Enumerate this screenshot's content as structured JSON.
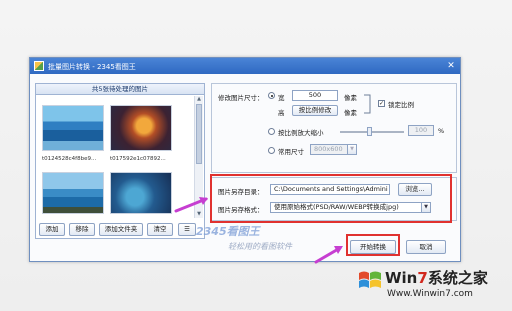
{
  "window": {
    "title": "批量图片转换 - 2345看图王",
    "close_glyph": "✕"
  },
  "left_panel": {
    "header": "共5张待处理的图片",
    "captions": [
      "t0124528c4f8be9...",
      "t017592e1c07892..."
    ],
    "buttons": {
      "add": "添加",
      "remove": "移除",
      "add_folder": "添加文件夹",
      "clear": "清空",
      "view_toggle": "☰"
    }
  },
  "resize": {
    "label": "修改图片尺寸：",
    "width_label": "宽",
    "width_value": "500",
    "width_unit": "像素",
    "height_label": "高",
    "height_button": "按比例修改",
    "height_unit": "像素",
    "lock_ratio_label": "锁定比例",
    "lock_ratio_checked": true,
    "scale_label": "按比例放大缩小",
    "scale_value": "100",
    "scale_unit": "%",
    "common_size_label": "常用尺寸",
    "common_size_value": "800x600"
  },
  "output": {
    "dir_label": "图片另存目录：",
    "dir_value": "C:\\Documents and Settings\\Admini",
    "browse_button": "浏览...",
    "format_label": "图片另存格式：",
    "format_value": "使用原始格式(PSD/RAW/WEBP转换成jpg)"
  },
  "actions": {
    "start": "开始转换",
    "cancel": "取消"
  },
  "watermark": {
    "logo": "2345看图王",
    "slogan": "轻松用的看图软件"
  },
  "site": {
    "name_prefix": "Win",
    "name_seven": "7",
    "name_suffix": "系统之家",
    "url": "Www.Winwin7.com"
  },
  "colors": {
    "highlight_box": "#e0312f",
    "arrow": "#c63ed1",
    "titlebar": "#2f69c2"
  }
}
